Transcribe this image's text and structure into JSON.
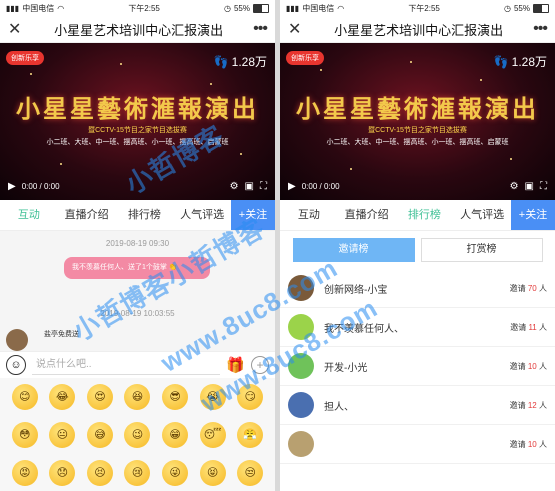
{
  "status": {
    "carrier": "中国电信",
    "time": "下午2:55",
    "battery": "55%"
  },
  "title": "小星星艺术培训中心汇报演出",
  "video": {
    "logo": "创新乐享",
    "views": "1.28万",
    "headline": "小星星藝術滙報演出",
    "sub1": "暨CCTV-15节目之家节目选拔赛",
    "sub2": "小二班、大班、中一班、摆高班、小一班、摆高班、启蒙班",
    "time": "0:00 / 0:00"
  },
  "left": {
    "tabs": [
      "互动",
      "直播介绍",
      "排行榜",
      "人气评选"
    ],
    "follow": "+关注",
    "chat": {
      "ts1": "2019-08-19 09:30",
      "bubble": "我不羡慕任何人、送了1个鼓掌",
      "ts2": "2019-08-19 10:03:55",
      "sender": "盐亭免费送"
    },
    "input_placeholder": "说点什么吧..",
    "emojis": [
      "😊",
      "😂",
      "😍",
      "😆",
      "😎",
      "😭",
      "😏",
      "😳",
      "😐",
      "😅",
      "😉",
      "😁",
      "😴",
      "😤",
      "😡",
      "😞",
      "😣",
      "😢",
      "😜",
      "😝",
      "😒"
    ]
  },
  "right": {
    "tabs": [
      "互动",
      "直播介绍",
      "排行榜",
      "人气评选"
    ],
    "follow": "+关注",
    "subtabs": [
      "邀请榜",
      "打赏榜"
    ],
    "invite_prefix": "邀请",
    "unit": "人",
    "ranking": [
      {
        "name": "创新网络-小宝",
        "count": "70",
        "color": "#7a5a3a"
      },
      {
        "name": "我不羡慕任何人、",
        "count": "11",
        "color": "#9bd34a"
      },
      {
        "name": "开发-小光",
        "count": "10",
        "color": "#6fc25a"
      },
      {
        "name": "担人、",
        "count": "12",
        "color": "#4a6fb0"
      },
      {
        "name": "",
        "count": "10",
        "color": "#b8a070"
      }
    ]
  },
  "watermark": {
    "lines": [
      "小哲博客",
      "小哲博客小哲博客",
      "www.8uc8.com",
      "www.8uc8.com"
    ]
  },
  "colors": {
    "accent_green": "#3ec095",
    "follow_blue": "#4a8ff5",
    "bubble_pink": "#f38aa4",
    "count_red": "#e23b3b"
  }
}
